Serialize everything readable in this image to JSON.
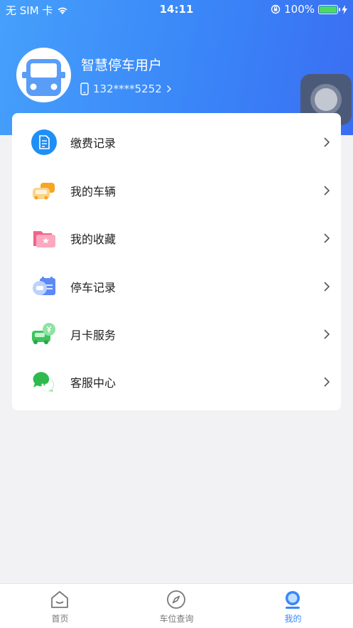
{
  "status_bar": {
    "carrier": "无 SIM 卡",
    "time": "14:11",
    "battery": "100%"
  },
  "profile": {
    "username": "智慧停车用户",
    "phone": "132****5252"
  },
  "menu": {
    "items": [
      {
        "label": "缴费记录",
        "icon": "payment-record-icon"
      },
      {
        "label": "我的车辆",
        "icon": "my-vehicles-icon"
      },
      {
        "label": "我的收藏",
        "icon": "favorites-folder-icon"
      },
      {
        "label": "停车记录",
        "icon": "parking-record-icon"
      },
      {
        "label": "月卡服务",
        "icon": "monthly-card-icon"
      },
      {
        "label": "客服中心",
        "icon": "customer-service-icon"
      }
    ]
  },
  "tabbar": {
    "tabs": [
      {
        "label": "首页",
        "icon": "home-icon",
        "active": false
      },
      {
        "label": "车位查询",
        "icon": "compass-icon",
        "active": false
      },
      {
        "label": "我的",
        "icon": "profile-icon",
        "active": true
      }
    ]
  },
  "colors": {
    "header_start": "#46a0fb",
    "header_end": "#3a6ef2",
    "accent": "#3a86f8",
    "background": "#f2f2f4"
  }
}
